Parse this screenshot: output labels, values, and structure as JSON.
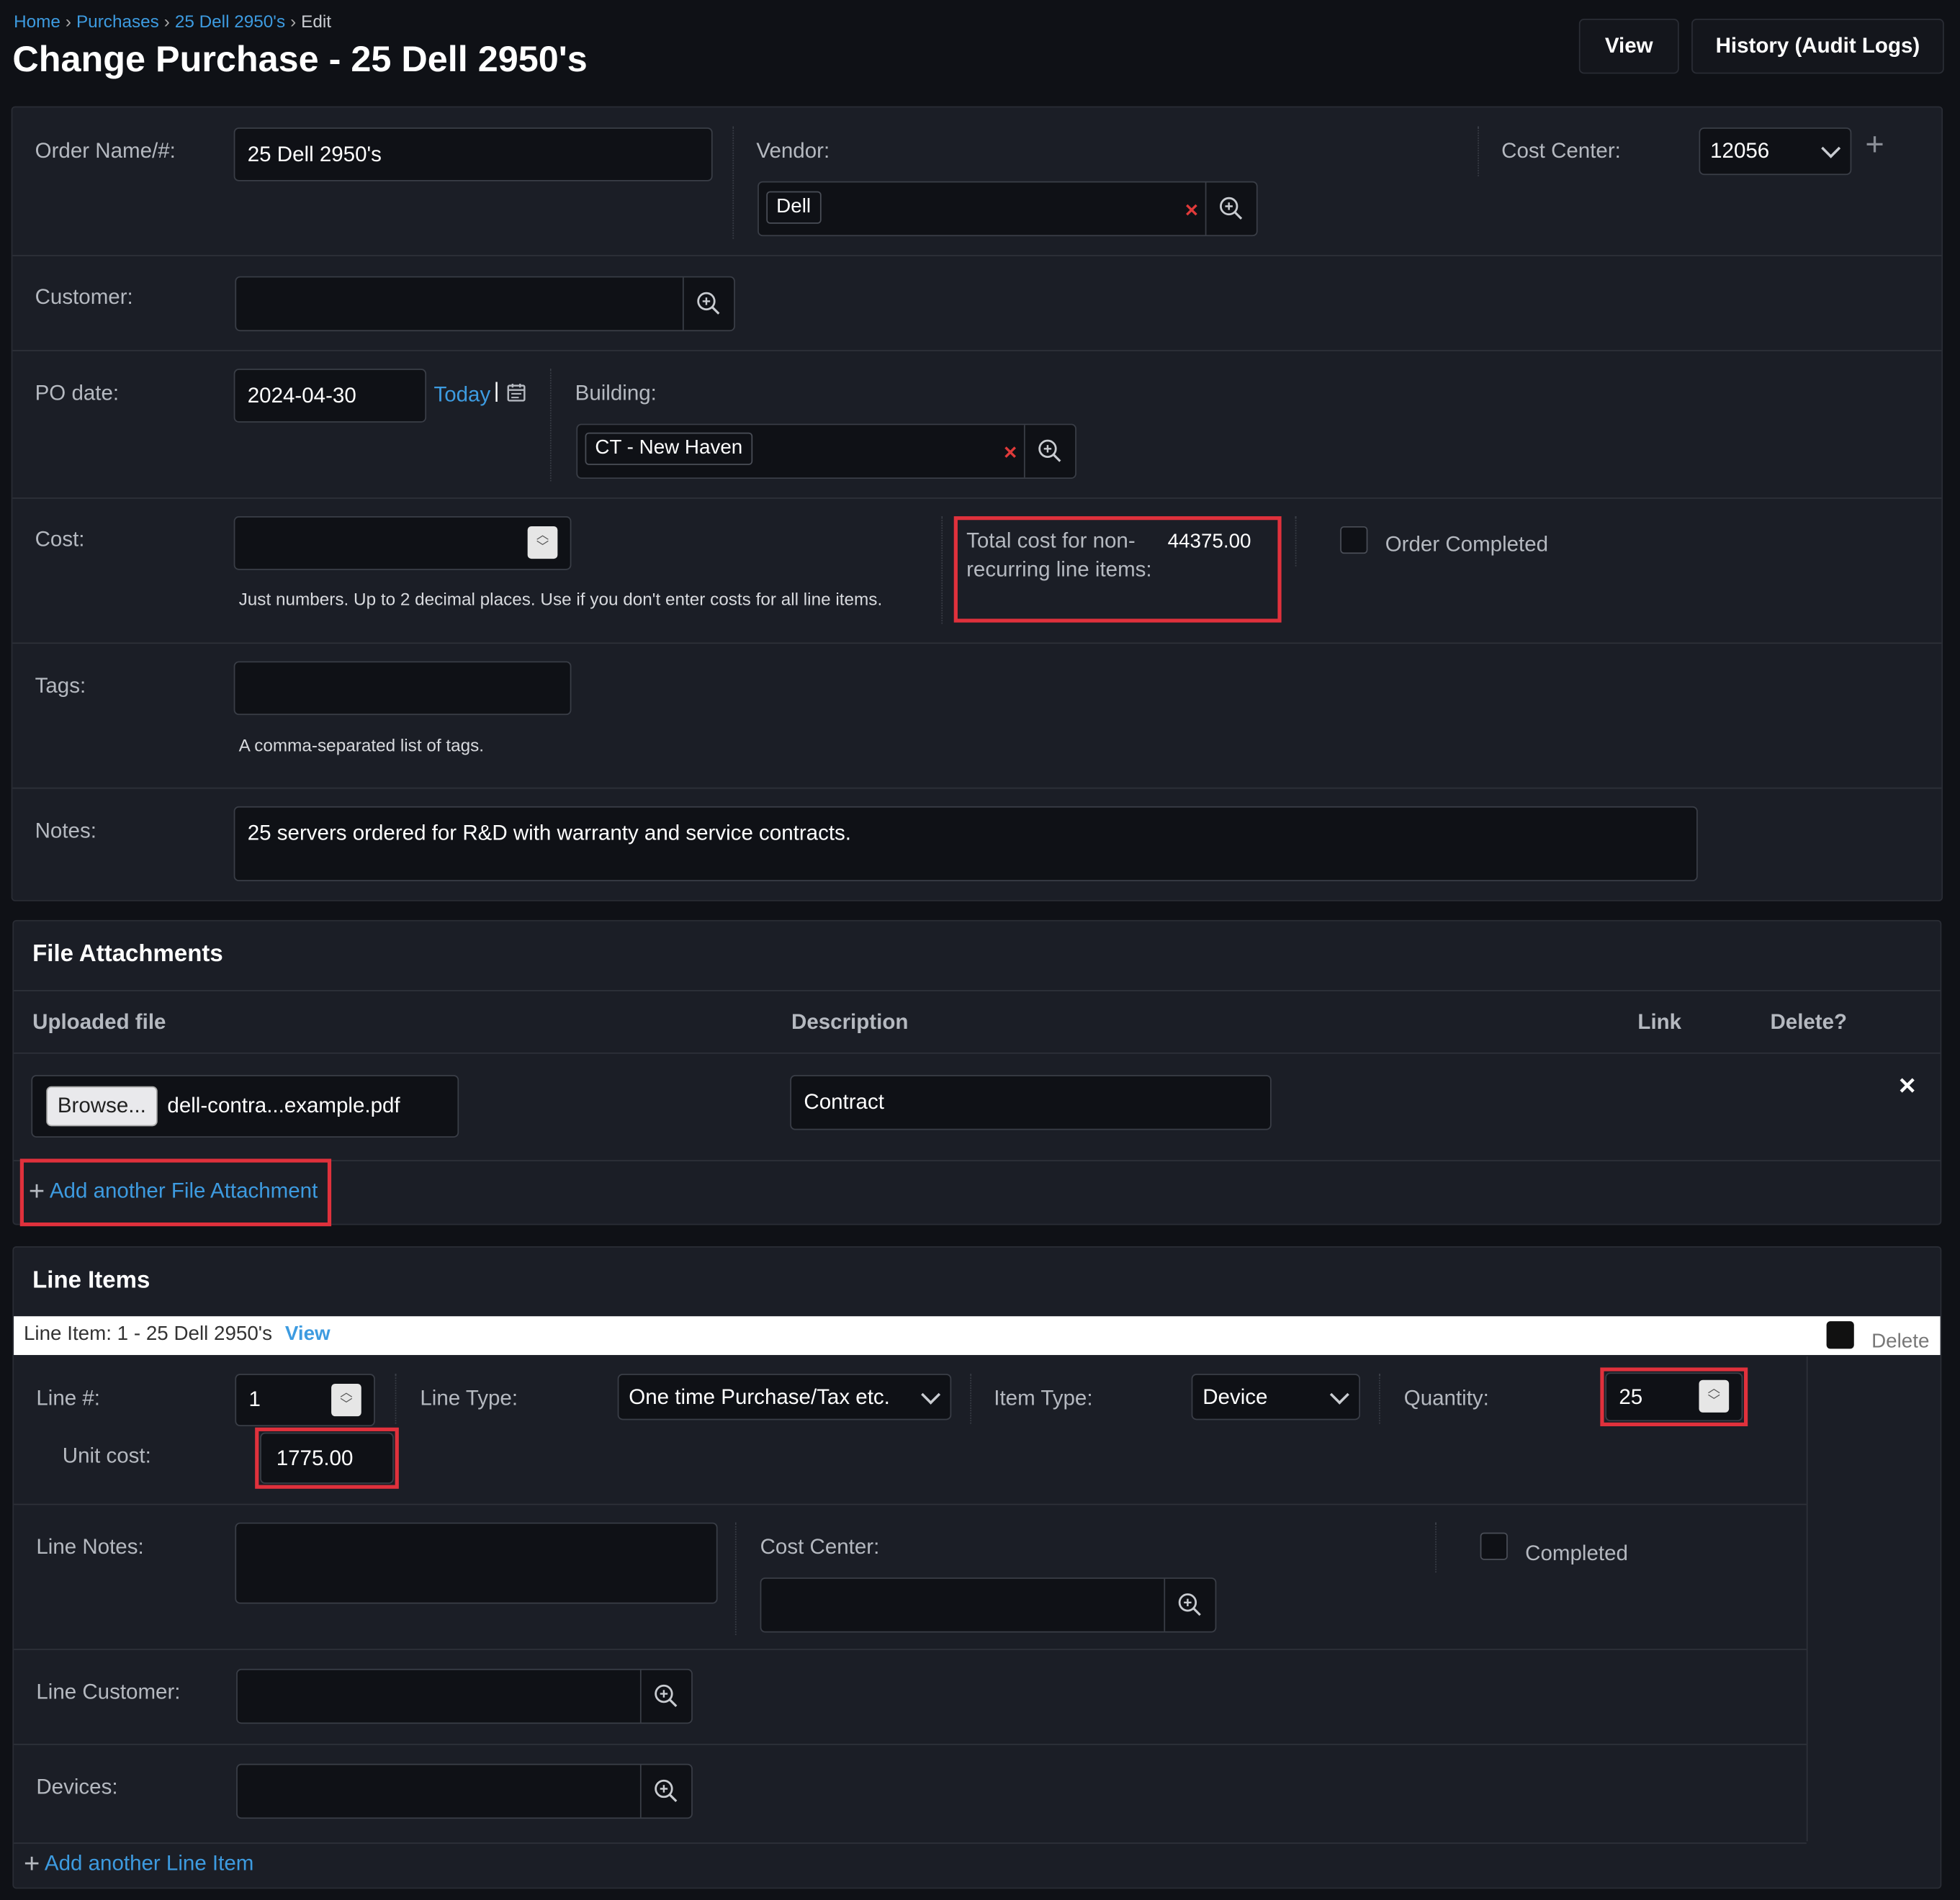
{
  "breadcrumb": {
    "home": "Home",
    "purchases": "Purchases",
    "item": "25 Dell 2950's",
    "current": "Edit"
  },
  "page_title": "Change Purchase - 25 Dell 2950's",
  "buttons": {
    "view": "View",
    "history": "History (Audit Logs)"
  },
  "form": {
    "order_name_label": "Order Name/#:",
    "order_name_value": "25 Dell 2950's",
    "vendor_label": "Vendor:",
    "vendor_value": "Dell",
    "cost_center_label": "Cost Center:",
    "cost_center_value": "12056",
    "customer_label": "Customer:",
    "po_date_label": "PO date:",
    "po_date_value": "2024-04-30",
    "today_link": "Today",
    "building_label": "Building:",
    "building_value": "CT - New Haven",
    "cost_label": "Cost:",
    "cost_help": "Just numbers. Up to 2 decimal places. Use if you don't enter costs for all line items.",
    "total_cost_label": "Total cost for non-recurring line items:",
    "total_cost_value": "44375.00",
    "order_completed_label": "Order Completed",
    "tags_label": "Tags:",
    "tags_help": "A comma-separated list of tags.",
    "notes_label": "Notes:",
    "notes_value": "25 servers ordered for R&D with warranty and service contracts."
  },
  "attachments": {
    "title": "File Attachments",
    "col_file": "Uploaded file",
    "col_description": "Description",
    "col_link": "Link",
    "col_delete": "Delete?",
    "browse_label": "Browse...",
    "file_name": "dell-contra...example.pdf",
    "description_value": "Contract",
    "add_link": "Add another File Attachment"
  },
  "line_items": {
    "title": "Line Items",
    "header_text": "Line Item: 1 - 25 Dell 2950's",
    "header_view": "View",
    "delete_label": "Delete",
    "line_no_label": "Line #:",
    "line_no_value": "1",
    "line_type_label": "Line Type:",
    "line_type_value": "One time Purchase/Tax etc.",
    "item_type_label": "Item Type:",
    "item_type_value": "Device",
    "quantity_label": "Quantity:",
    "quantity_value": "25",
    "unit_cost_label": "Unit cost:",
    "unit_cost_value": "1775.00",
    "line_notes_label": "Line Notes:",
    "cost_center_label": "Cost Center:",
    "completed_label": "Completed",
    "line_customer_label": "Line Customer:",
    "devices_label": "Devices:",
    "add_link": "Add another Line Item"
  }
}
